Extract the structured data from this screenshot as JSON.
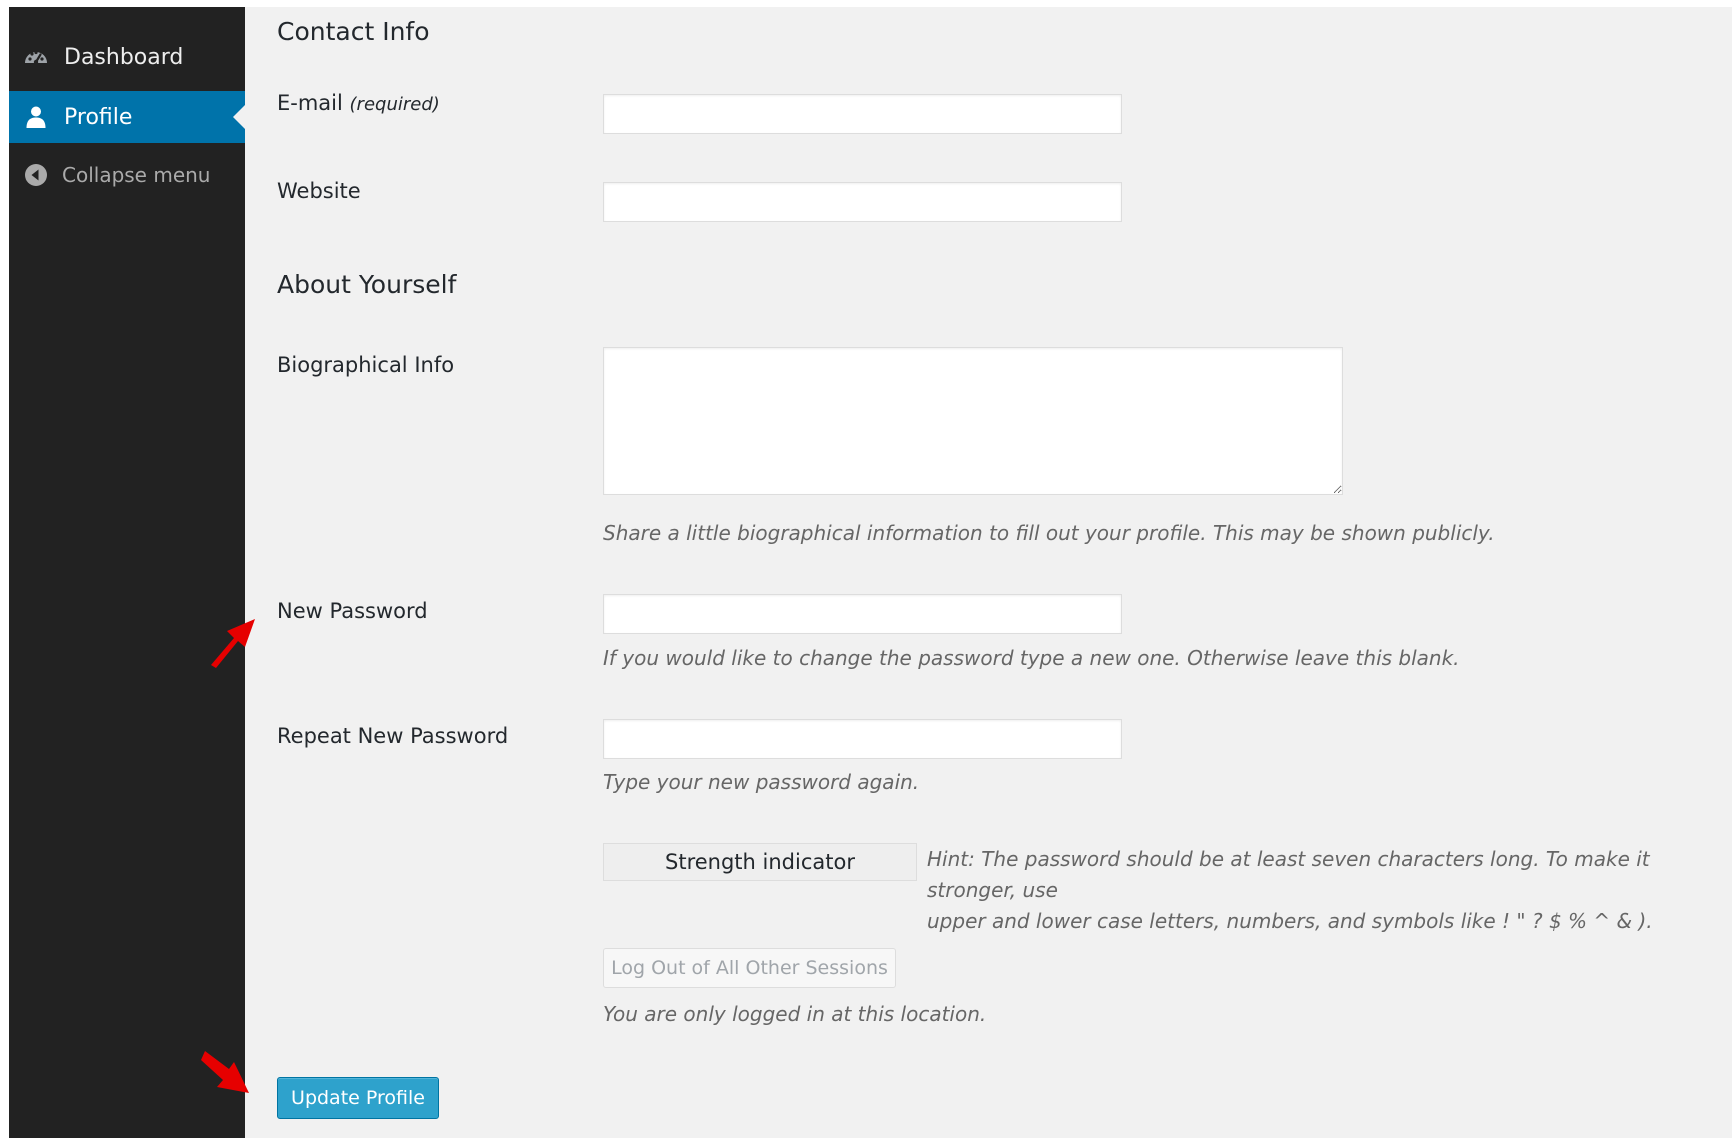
{
  "sidebar": {
    "items": [
      {
        "label": "Dashboard",
        "icon": "dashboard-icon"
      },
      {
        "label": "Profile",
        "icon": "user-icon",
        "active": true
      },
      {
        "label": "Collapse menu",
        "icon": "collapse-arrow-icon"
      }
    ],
    "background_color": "#222222",
    "active_color": "#0073aa"
  },
  "contact_info": {
    "heading": "Contact Info",
    "email": {
      "label": "E-mail",
      "note": "(required)",
      "value": ""
    },
    "website": {
      "label": "Website",
      "value": ""
    }
  },
  "about": {
    "heading": "About Yourself",
    "bio": {
      "label": "Biographical Info",
      "value": "",
      "description": "Share a little biographical information to fill out your profile. This may be shown publicly."
    },
    "new_password": {
      "label": "New Password",
      "value": "",
      "description": "If you would like to change the password type a new one. Otherwise leave this blank."
    },
    "repeat_password": {
      "label": "Repeat New Password",
      "value": "",
      "description": "Type your new password again."
    },
    "strength": {
      "label": "Strength indicator",
      "hint_line1": "Hint: The password should be at least seven characters long. To make it stronger, use",
      "hint_line2": "upper and lower case letters, numbers, and symbols like ! \" ? $ % ^ & )."
    },
    "sessions": {
      "button_label": "Log Out of All Other Sessions",
      "description": "You are only logged in at this location."
    }
  },
  "submit": {
    "label": "Update Profile",
    "color": "#2ea2cc"
  },
  "annotations": {
    "arrow_color": "#e60000",
    "arrows": [
      "new-password-arrow",
      "update-profile-arrow"
    ]
  }
}
